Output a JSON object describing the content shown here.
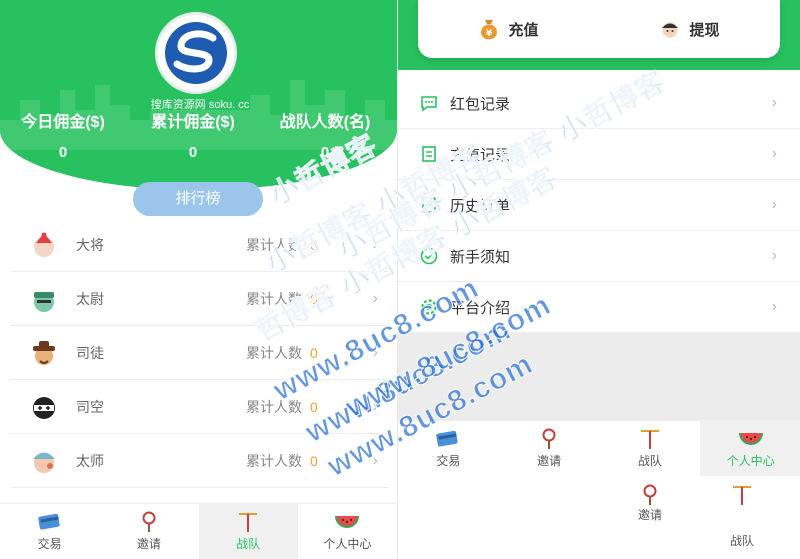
{
  "left": {
    "logo_caption": "搜库资源网 soku. cc",
    "stats": [
      {
        "label": "今日佣金($)",
        "value": "0"
      },
      {
        "label": "累计佣金($)",
        "value": "0"
      },
      {
        "label": "战队人数(名)",
        "value": "0"
      }
    ],
    "rank_button": "排行榜",
    "ranks": [
      {
        "name": "大将",
        "count_label": "累计人数",
        "count": "0",
        "icon": "general-avatar-icon"
      },
      {
        "name": "太尉",
        "count_label": "累计人数",
        "count": "0",
        "icon": "commander-avatar-icon"
      },
      {
        "name": "司徒",
        "count_label": "累计人数",
        "count": "0",
        "icon": "minister-avatar-icon"
      },
      {
        "name": "司空",
        "count_label": "累计人数",
        "count": "0",
        "icon": "masked-avatar-icon"
      },
      {
        "name": "太师",
        "count_label": "累计人数",
        "count": "0",
        "icon": "grand-tutor-avatar-icon"
      }
    ]
  },
  "tabs": [
    {
      "label": "交易",
      "icon": "card-icon"
    },
    {
      "label": "邀请",
      "icon": "magnifier-icon"
    },
    {
      "label": "战队",
      "icon": "team-icon"
    },
    {
      "label": "个人中心",
      "icon": "watermelon-icon"
    }
  ],
  "right": {
    "actions": [
      {
        "label": "充值",
        "icon": "money-bag-icon"
      },
      {
        "label": "提现",
        "icon": "face-icon"
      }
    ],
    "menu": [
      {
        "label": "红包记录",
        "icon": "chat-bubble-icon"
      },
      {
        "label": "充值记录",
        "icon": "record-icon"
      },
      {
        "label": "历史订单",
        "icon": "order-icon"
      },
      {
        "label": "新手须知",
        "icon": "check-icon"
      },
      {
        "label": "平台介绍",
        "icon": "settings-icon"
      }
    ],
    "ghost_tabs": [
      {
        "label": "邀请"
      },
      {
        "label": "战队"
      }
    ]
  },
  "watermark": [
    "小哲博客",
    "小哲博客 小哲博客",
    "小哲博客 小哲博客 小哲博客",
    "哲博客 小哲博客 小哲博客",
    "www.8uc8.com",
    "www.8uc8.com",
    "www.8uc8.com",
    "www.8uc8.com"
  ],
  "colors": {
    "brand_green": "#27c25f",
    "accent_orange": "#f0a030",
    "rank_button_blue": "#9cc5ec"
  }
}
